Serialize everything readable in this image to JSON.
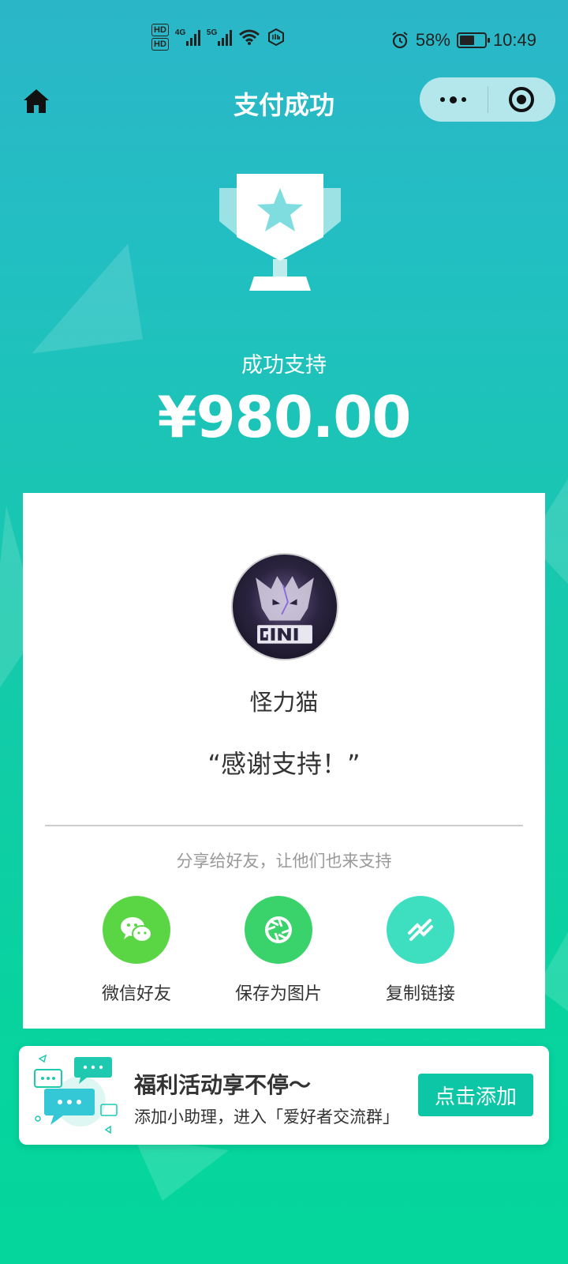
{
  "status_bar": {
    "hd1": "HD",
    "hd2": "HD",
    "net1": "4G",
    "net2": "5G",
    "battery_percent": "58%",
    "battery_level": 0.58,
    "time": "10:49"
  },
  "nav": {
    "title": "支付成功",
    "home_icon": "home-icon",
    "more_icon": "more-dots-icon",
    "close_icon": "target-close-icon"
  },
  "hero": {
    "success_label": "成功支持",
    "amount": "¥980.00"
  },
  "card": {
    "author_name": "怪力猫",
    "thanks_message": "“感谢支持！”",
    "share_hint": "分享给好友，让他们也来支持",
    "share_options": [
      {
        "label": "微信好友",
        "icon": "wechat-icon",
        "color": "#5ad645"
      },
      {
        "label": "保存为图片",
        "icon": "camera-shutter-icon",
        "color": "#3ad26a"
      },
      {
        "label": "复制链接",
        "icon": "link-icon",
        "color": "#3ddfc0"
      }
    ]
  },
  "banner": {
    "title": "福利活动享不停～",
    "subtitle": "添加小助理，进入「爱好者交流群」",
    "button_label": "点击添加"
  },
  "colors": {
    "accent": "#0dc6a6",
    "bg_top": "#2bb6c8",
    "bg_bottom": "#04d69c"
  }
}
